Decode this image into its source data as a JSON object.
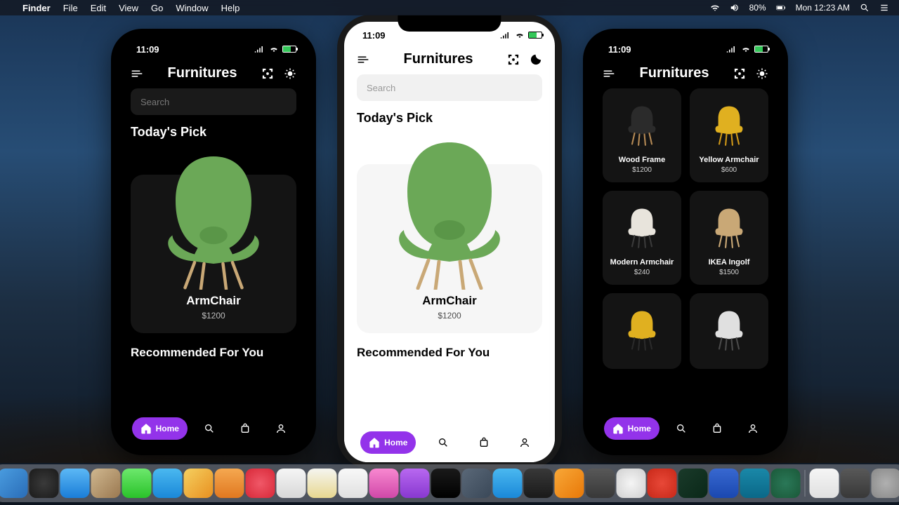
{
  "menubar": {
    "app": "Finder",
    "items": [
      "File",
      "Edit",
      "View",
      "Go",
      "Window",
      "Help"
    ],
    "battery": "80%",
    "clock": "Mon 12:23 AM"
  },
  "status": {
    "time": "11:09"
  },
  "header": {
    "title": "Furnitures",
    "menu_icon": "menu",
    "qr_icon": "qr",
    "sun_icon": "sun",
    "moon_icon": "moon"
  },
  "search": {
    "placeholder": "Search"
  },
  "section1": {
    "title": "Today's Pick"
  },
  "pick": {
    "name": "ArmChair",
    "price": "$1200"
  },
  "section2": {
    "title": "Recommended For You"
  },
  "nav": {
    "home": "Home"
  },
  "grid": [
    {
      "name": "Wood Frame",
      "price": "$1200",
      "color": "#2b2b2b",
      "frame": "#b58a55"
    },
    {
      "name": "Yellow Armchair",
      "price": "$600",
      "color": "#e0b020",
      "frame": "#d09818"
    },
    {
      "name": "Modern Armchair",
      "price": "$240",
      "color": "#e8e4dc",
      "frame": "#3a3a3a"
    },
    {
      "name": "IKEA Ingolf",
      "price": "$1500",
      "color": "#c9a876",
      "frame": "#c9a876"
    },
    {
      "name": "",
      "price": "",
      "color": "#e0b020",
      "frame": "#2a2a2a"
    },
    {
      "name": "",
      "price": "",
      "color": "#e0e0e0",
      "frame": "#4a4a4a"
    }
  ],
  "dock_colors": [
    "linear-gradient(135deg,#4a9de0,#2a6db8)",
    "radial-gradient(circle,#3a3a3a,#1a1a1a)",
    "linear-gradient(180deg,#5cb8f5,#1a7dd8)",
    "linear-gradient(135deg,#d0b890,#9a7850)",
    "linear-gradient(180deg,#6de86d,#2ac22a)",
    "linear-gradient(180deg,#4ab8f0,#1a88d8)",
    "linear-gradient(135deg,#f5d060,#e89020)",
    "linear-gradient(180deg,#f5a850,#e07820)",
    "radial-gradient(circle,#f05868,#d82838)",
    "linear-gradient(180deg,#f5f5f5,#d8d8d8)",
    "linear-gradient(180deg,#f5f5f0,#e8d890)",
    "linear-gradient(180deg,#f8f8f8,#e0e0e0)",
    "linear-gradient(180deg,#f888d0,#d048a8)",
    "linear-gradient(180deg,#b868f0,#8838d0)",
    "linear-gradient(180deg,#1a1a1a,#000)",
    "linear-gradient(135deg,#5a6878,#3a4858)",
    "linear-gradient(180deg,#4ab8f0,#1a88d8)",
    "linear-gradient(180deg,#383838,#1a1a1a)",
    "linear-gradient(135deg,#f8a838,#e87808)",
    "linear-gradient(180deg,#585858,#383838)",
    "radial-gradient(circle,#f5f5f5,#d0d0d0)",
    "radial-gradient(circle,#e84838,#c82818)",
    "linear-gradient(135deg,#1a3a2a,#0a2818)",
    "linear-gradient(180deg,#3868d0,#1a48b0)",
    "linear-gradient(180deg,#1a88a8,#0a6888)",
    "radial-gradient(circle,#2a7858,#1a5838)"
  ],
  "dock_right": [
    "linear-gradient(180deg,#f5f5f5,#e0e0e0)",
    "linear-gradient(180deg,#585858,#383838)",
    "radial-gradient(circle,#b0b0b0,#888)"
  ]
}
